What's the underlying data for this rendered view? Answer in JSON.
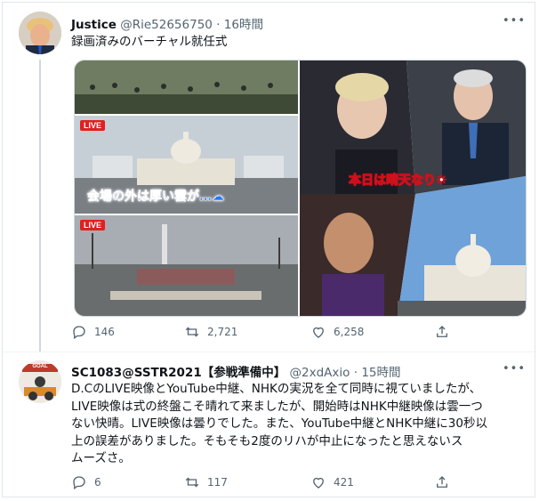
{
  "tweet1": {
    "display_name": "Justice",
    "handle": "@Rie52656750",
    "separator": "·",
    "time": "16時間",
    "more": "•••",
    "text": "録画済みのバーチャル就任式",
    "media": {
      "panel1_label": "LIVE",
      "panel1_caption": "会場の外は厚い雲が…☁",
      "panel2_label": "LIVE",
      "panel3_caption": "本日は晴天なり☀"
    },
    "actions": {
      "reply_count": "146",
      "retweet_count": "2,721",
      "like_count": "6,258"
    }
  },
  "tweet2": {
    "display_name": "SC1083@SSTR2021【参戦準備中】",
    "handle": "@2xdAxio",
    "separator": "·",
    "time": "15時間",
    "more": "•••",
    "avatar_text": "GOAL",
    "text_lines": [
      "D.CのLIVE映像とYouTube中継、NHKの実況を全て同時に視ていましたが、",
      "LIVE映像は式の終盤こそ晴れて来ましたが、開始時はNHK中継映像は雲一つ",
      "ない快晴。LIVE映像は曇りでした。また、YouTube中継とNHK中継に30秒以",
      "上の誤差がありました。そもそも2度のリハが中止になったと思えないス",
      "ムーズさ。"
    ],
    "actions": {
      "reply_count": "6",
      "retweet_count": "117",
      "like_count": "421"
    }
  },
  "colors": {
    "text": "#0f1419",
    "muted": "#536471",
    "live_red": "#e02020",
    "caption_blue": "#1e78ff"
  },
  "icons": [
    "reply-icon",
    "retweet-icon",
    "like-icon",
    "share-icon",
    "more-icon"
  ]
}
